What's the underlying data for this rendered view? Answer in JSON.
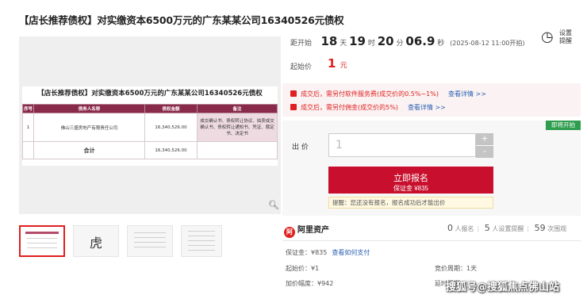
{
  "page": {
    "title": "【店长推荐债权】对实缴资本6500万元的广东某某公司16340526元债权"
  },
  "document": {
    "title": "【店长推荐债权】对实缴资本6500万元的广东某某公司16340526元债权",
    "headers": [
      "序号",
      "债务人名称",
      "债权金额",
      "备注"
    ],
    "row": {
      "index": "1",
      "debtor": "佛山三盛房地产有限责任公司",
      "amount": "16,340,526.00",
      "note": "成交确认书、债权转让协议、拍卖成交确认书、债权转让通知书、凭证、裁定书、决定书"
    },
    "total_label": "合计",
    "total_amount": "16,340,526.00"
  },
  "thumbnails": [
    {
      "name": "thumb-1",
      "selected": true
    },
    {
      "name": "thumb-2",
      "char": "虎"
    },
    {
      "name": "thumb-3"
    },
    {
      "name": "thumb-4"
    }
  ],
  "countdown": {
    "label": "距开始",
    "days": "18",
    "days_unit": "天",
    "hours": "19",
    "hours_unit": "时",
    "minutes": "20",
    "minutes_unit": "分",
    "seconds": "06.9",
    "seconds_unit": "秒",
    "start_time": "(2025-08-12 11:00开拍)"
  },
  "remind": {
    "line1": "设置",
    "line2": "提醒"
  },
  "start_price": {
    "label": "起始价",
    "value": "1",
    "unit": "元"
  },
  "notices": [
    {
      "text": "成交后，需另付软件服务费(成交价的0.5%~1%)",
      "link": "查看详情 >>"
    },
    {
      "text": "成交后，需另付佣金(成交价的5%)",
      "link": "查看详情 >>"
    }
  ],
  "bid": {
    "tag": "即将开拍",
    "label": "出 价",
    "value": "1",
    "plus": "+",
    "minus": "-",
    "signup_label": "立即报名",
    "deposit_label": "保证金 ¥835",
    "hint": "提醒：您还没有报名，报名成功后才能出价"
  },
  "brand": {
    "name": "阿里资产",
    "logo": "阿"
  },
  "stats": {
    "signups": "0",
    "signups_label": "人报名",
    "reminders": "5",
    "reminders_label": "人设置提醒",
    "views": "59",
    "views_label": "次围观"
  },
  "details": {
    "deposit": "保证金：¥835",
    "deposit_link": "查看如何支付",
    "start_price": "起始价：¥1",
    "cycle": "竞价周期：1天",
    "increment": "加价幅度：¥942",
    "extension": "延时周期"
  },
  "watermark": "搜狐号@搜狐焦点佛山站",
  "colors": {
    "accent": "#e02020",
    "button": "#c8102e",
    "tag": "#2e9e4e",
    "link": "#2b5fb3"
  }
}
